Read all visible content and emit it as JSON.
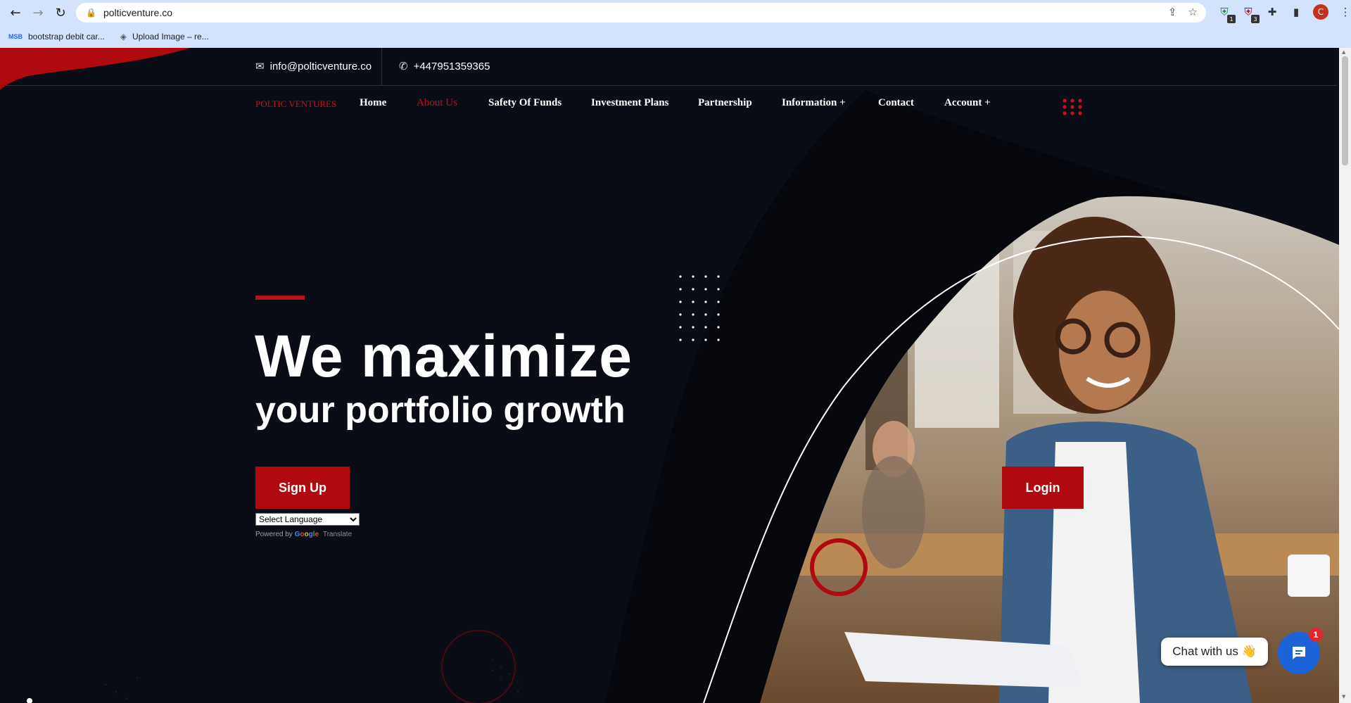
{
  "browser": {
    "url": "polticventure.co",
    "bookmarks": [
      {
        "icon": "MSB",
        "label": "bootstrap debit car..."
      },
      {
        "icon": "stack-icon",
        "label": "Upload Image – re..."
      }
    ],
    "profile_initial": "C",
    "extension_badges": [
      "1",
      "3"
    ]
  },
  "topbar": {
    "email": "info@polticventure.co",
    "phone": "+447951359365"
  },
  "nav": {
    "brand": "POLTIC VENTURES",
    "items": [
      {
        "label": "Home",
        "active": false
      },
      {
        "label": "About Us",
        "active": true
      },
      {
        "label": "Safety Of Funds",
        "active": false
      },
      {
        "label": "Investment Plans",
        "active": false
      },
      {
        "label": "Partnership",
        "active": false
      },
      {
        "label": "Information +",
        "active": false
      },
      {
        "label": "Contact",
        "active": false
      },
      {
        "label": "Account +",
        "active": false
      }
    ]
  },
  "hero": {
    "headline": "We maximize",
    "subheadline": "your portfolio growth",
    "signup_label": "Sign Up",
    "login_label": "Login"
  },
  "translate": {
    "select_value": "Select Language",
    "powered_by": "Powered by",
    "google": "Google",
    "translate": "Translate"
  },
  "chat": {
    "label": "Chat with us 👋",
    "badge": "1"
  },
  "colors": {
    "accent_red": "#b0090f",
    "background": "#0a0d16",
    "chat_blue": "#1c63d8",
    "browser_chrome": "#d3e3fd"
  }
}
